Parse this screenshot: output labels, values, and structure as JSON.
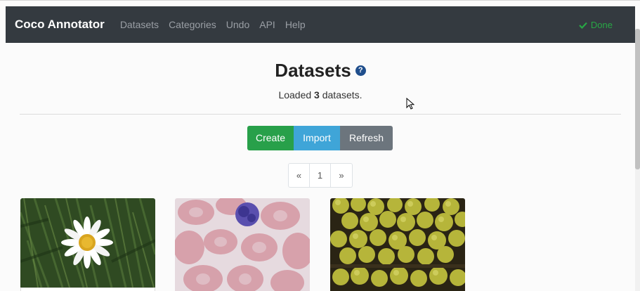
{
  "navbar": {
    "brand": "Coco Annotator",
    "links": [
      "Datasets",
      "Categories",
      "Undo",
      "API",
      "Help"
    ],
    "status": "Done",
    "status_color": "#28a745",
    "background": "#343a40"
  },
  "main": {
    "title": "Datasets",
    "loaded_prefix": "Loaded ",
    "loaded_count": "3",
    "loaded_suffix": " datasets."
  },
  "buttons": {
    "create": "Create",
    "import": "Import",
    "refresh": "Refresh"
  },
  "pagination": {
    "prev": "«",
    "current": "1",
    "next": "»"
  },
  "datasets": [
    {
      "thumbnail": "daisy-flower"
    },
    {
      "thumbnail": "blood-cells"
    },
    {
      "thumbnail": "green-apples"
    }
  ],
  "icons": {
    "help": "question-circle-icon",
    "status": "check-icon"
  }
}
